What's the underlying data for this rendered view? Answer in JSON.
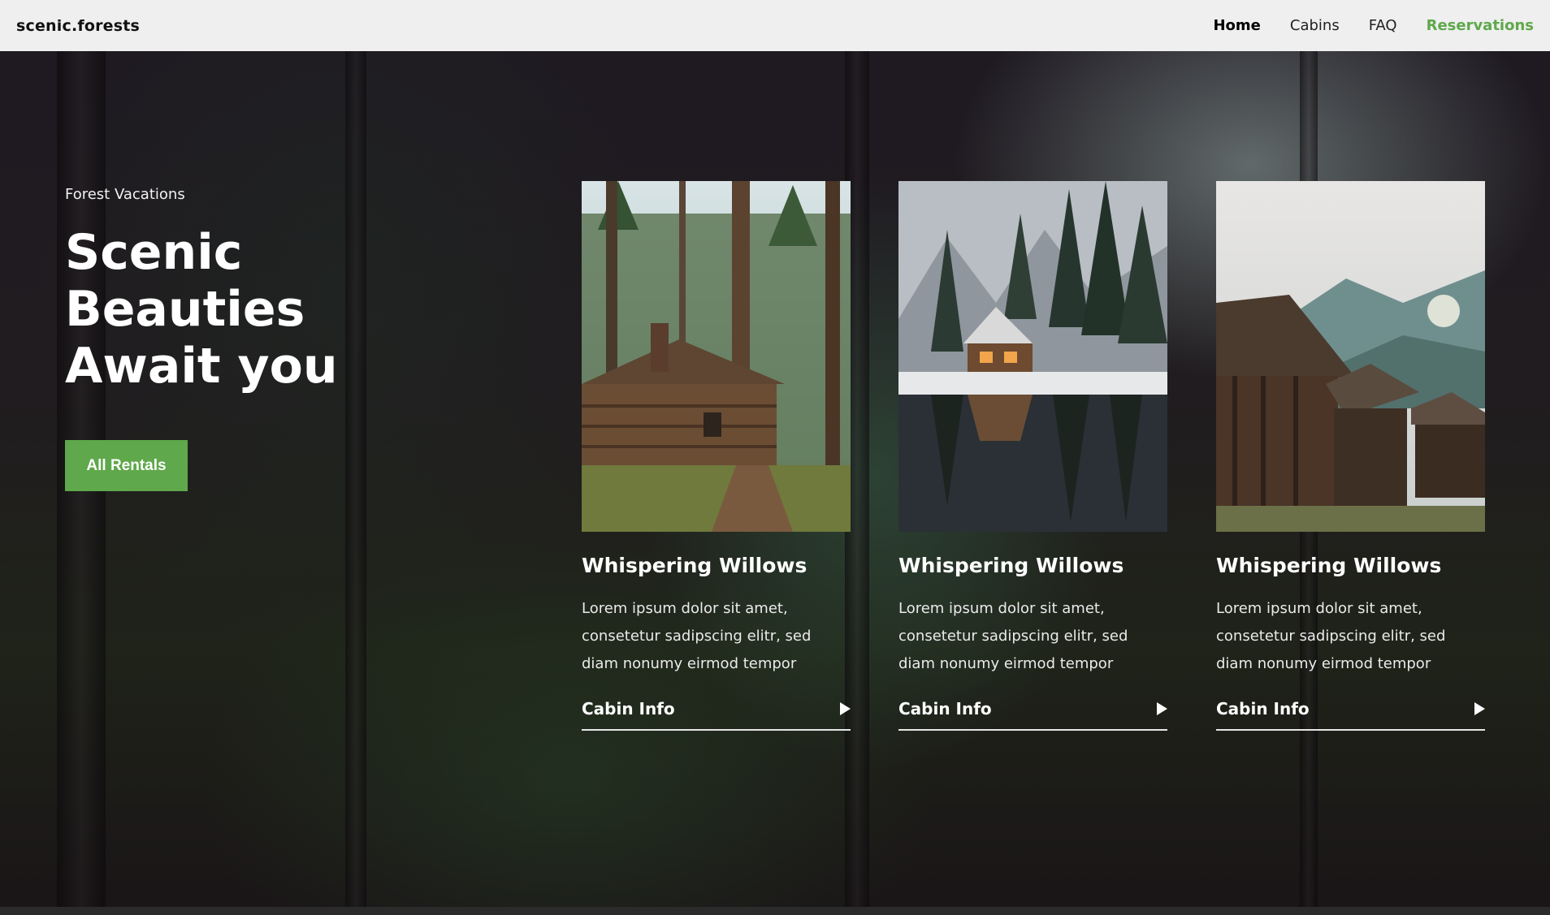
{
  "brand": "scenic.forests",
  "nav": {
    "home": "Home",
    "cabins": "Cabins",
    "faq": "FAQ",
    "reservations": "Reservations"
  },
  "hero": {
    "eyebrow": "Forest Vacations",
    "headline": "Scenic Beauties Await you",
    "cta_label": "All Rentals"
  },
  "cards": [
    {
      "title": "Whispering Willows",
      "description": "Lorem ipsum dolor sit amet, consetetur sadipscing elitr, sed diam nonumy eirmod tempor",
      "link_label": "Cabin Info"
    },
    {
      "title": "Whispering Willows",
      "description": "Lorem ipsum dolor sit amet, consetetur sadipscing elitr, sed diam nonumy eirmod tempor",
      "link_label": "Cabin Info"
    },
    {
      "title": "Whispering Willows",
      "description": "Lorem ipsum dolor sit amet, consetetur sadipscing elitr, sed diam nonumy eirmod tempor",
      "link_label": "Cabin Info"
    }
  ],
  "colors": {
    "accent": "#5fa84b",
    "navbar_bg": "#efefef",
    "hero_bg": "#1f1a22"
  }
}
